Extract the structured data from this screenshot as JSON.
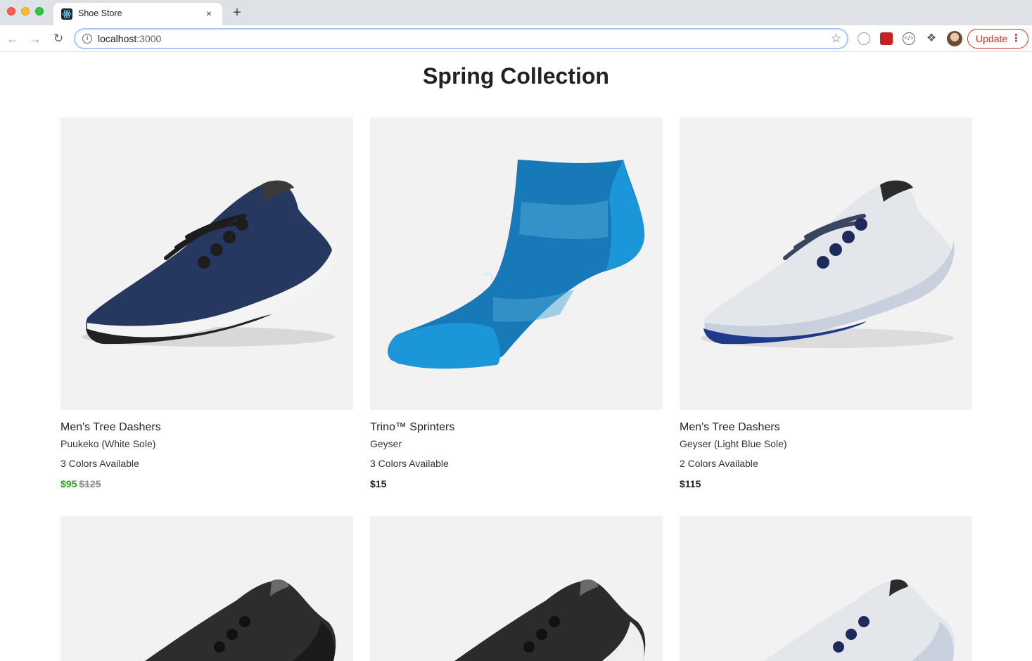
{
  "browser": {
    "tab_title": "Shoe Store",
    "tab_close": "×",
    "new_tab": "+",
    "url_host": "localhost",
    "url_port": ":3000",
    "update_label": "Update"
  },
  "page": {
    "title": "Spring Collection"
  },
  "products": [
    {
      "name": "Men's Tree Dashers",
      "variant": "Puukeko (White Sole)",
      "colors": "3 Colors Available",
      "price": "$95",
      "original_price": "$125",
      "on_sale": true,
      "image": "navy-shoe-icon"
    },
    {
      "name": "Trino™ Sprinters",
      "variant": "Geyser",
      "colors": "3 Colors Available",
      "price": "$15",
      "original_price": "",
      "on_sale": false,
      "image": "blue-sock-icon"
    },
    {
      "name": "Men's Tree Dashers",
      "variant": "Geyser (Light Blue Sole)",
      "colors": "2 Colors Available",
      "price": "$115",
      "original_price": "",
      "on_sale": false,
      "image": "light-shoe-icon"
    }
  ],
  "colors": {
    "sale_price": "#2e9c1f",
    "image_bg": "#f2f2f2",
    "update_red": "#d93025"
  }
}
